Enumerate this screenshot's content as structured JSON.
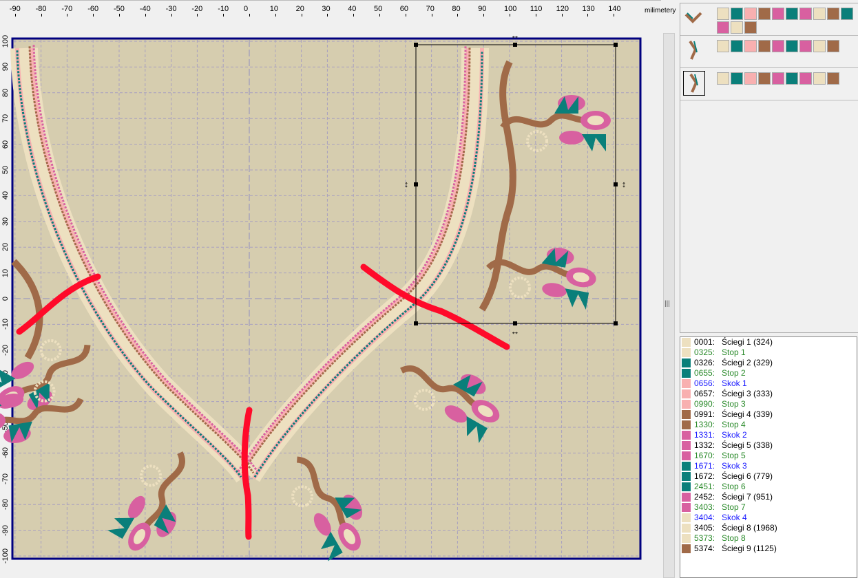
{
  "ruler": {
    "unit": "milimetery",
    "x_ticks": [
      "-90",
      "-80",
      "-70",
      "-60",
      "-50",
      "-40",
      "-30",
      "-20",
      "-10",
      "0",
      "10",
      "20",
      "30",
      "40",
      "50",
      "60",
      "70",
      "80",
      "90",
      "100",
      "110",
      "120",
      "130",
      "140"
    ],
    "y_ticks": [
      "100",
      "90",
      "80",
      "70",
      "60",
      "50",
      "40",
      "30",
      "20",
      "10",
      "0",
      "-10",
      "-20",
      "-30",
      "-40",
      "-50",
      "-60",
      "-70",
      "-80",
      "-90",
      "-100"
    ]
  },
  "colors": {
    "canvas": "#d6cdaf",
    "border": "#000080",
    "beige": "#ede0c0",
    "teal": "#0a7f7a",
    "lightpink": "#f8b0b0",
    "brown": "#a06a48",
    "pink": "#d860a0",
    "red": "#ff0a2a"
  },
  "thumbnails": [
    {
      "name": "design-1",
      "swatches": [
        "#ede0c0",
        "#0a7f7a",
        "#f8b0b0",
        "#a06a48",
        "#d860a0",
        "#0a7f7a",
        "#d860a0",
        "#ede0c0",
        "#a06a48",
        "#0a7f7a",
        "#d860a0",
        "#ede0c0",
        "#a06a48"
      ]
    },
    {
      "name": "design-2",
      "swatches": [
        "#ede0c0",
        "#0a7f7a",
        "#f8b0b0",
        "#a06a48",
        "#d860a0",
        "#0a7f7a",
        "#d860a0",
        "#ede0c0",
        "#a06a48"
      ]
    },
    {
      "name": "design-3",
      "swatches": [
        "#ede0c0",
        "#0a7f7a",
        "#f8b0b0",
        "#a06a48",
        "#d860a0",
        "#0a7f7a",
        "#d860a0",
        "#ede0c0",
        "#a06a48"
      ]
    }
  ],
  "stitch_list": [
    {
      "num": "0001:",
      "label": "Ściegi 1 (324)",
      "type": "black",
      "color": "#ede0c0"
    },
    {
      "num": "0325:",
      "label": "Stop 1",
      "type": "green",
      "color": "#ede0c0"
    },
    {
      "num": "0326:",
      "label": "Ściegi 2 (329)",
      "type": "black",
      "color": "#0a7f7a"
    },
    {
      "num": "0655:",
      "label": "Stop 2",
      "type": "green",
      "color": "#0a7f7a"
    },
    {
      "num": "0656:",
      "label": "Skok 1",
      "type": "blue",
      "color": "#f8b0b0"
    },
    {
      "num": "0657:",
      "label": "Ściegi 3 (333)",
      "type": "black",
      "color": "#f8b0b0"
    },
    {
      "num": "0990:",
      "label": "Stop 3",
      "type": "green",
      "color": "#f8b0b0"
    },
    {
      "num": "0991:",
      "label": "Ściegi 4 (339)",
      "type": "black",
      "color": "#a06a48"
    },
    {
      "num": "1330:",
      "label": "Stop 4",
      "type": "green",
      "color": "#a06a48"
    },
    {
      "num": "1331:",
      "label": "Skok 2",
      "type": "blue",
      "color": "#d860a0"
    },
    {
      "num": "1332:",
      "label": "Ściegi 5 (338)",
      "type": "black",
      "color": "#d860a0"
    },
    {
      "num": "1670:",
      "label": "Stop 5",
      "type": "green",
      "color": "#d860a0"
    },
    {
      "num": "1671:",
      "label": "Skok 3",
      "type": "blue",
      "color": "#0a7f7a"
    },
    {
      "num": "1672:",
      "label": "Ściegi 6 (779)",
      "type": "black",
      "color": "#0a7f7a"
    },
    {
      "num": "2451:",
      "label": "Stop 6",
      "type": "green",
      "color": "#0a7f7a"
    },
    {
      "num": "2452:",
      "label": "Ściegi 7 (951)",
      "type": "black",
      "color": "#d860a0"
    },
    {
      "num": "3403:",
      "label": "Stop 7",
      "type": "green",
      "color": "#d860a0"
    },
    {
      "num": "3404:",
      "label": "Skok 4",
      "type": "blue",
      "color": "#ede0c0"
    },
    {
      "num": "3405:",
      "label": "Ściegi 8 (1968)",
      "type": "black",
      "color": "#ede0c0"
    },
    {
      "num": "5373:",
      "label": "Stop 8",
      "type": "green",
      "color": "#ede0c0"
    },
    {
      "num": "5374:",
      "label": "Ściegi 9 (1125)",
      "type": "black",
      "color": "#a06a48"
    }
  ]
}
